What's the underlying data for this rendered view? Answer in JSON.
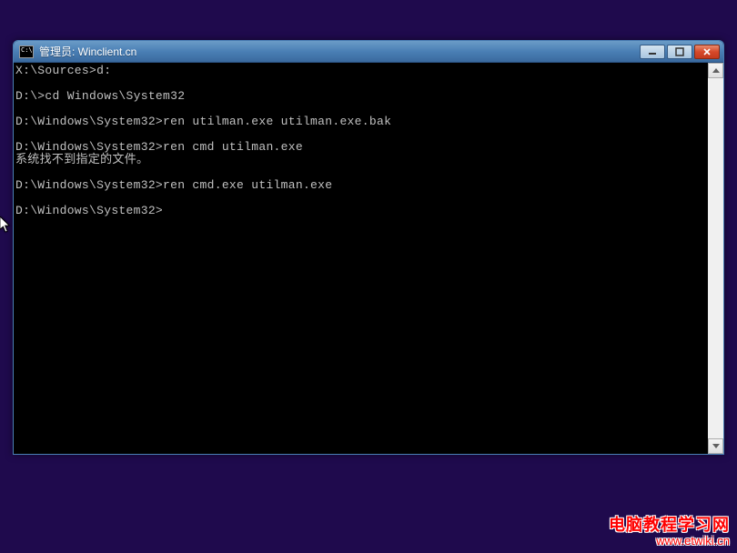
{
  "window": {
    "title": "管理员:  Winclient.cn"
  },
  "terminal": {
    "lines": [
      {
        "prompt": "X:\\Sources>",
        "command": "d:"
      },
      {
        "prompt": "",
        "command": ""
      },
      {
        "prompt": "D:\\>",
        "command": "cd Windows\\System32"
      },
      {
        "prompt": "",
        "command": ""
      },
      {
        "prompt": "D:\\Windows\\System32>",
        "command": "ren utilman.exe utilman.exe.bak"
      },
      {
        "prompt": "",
        "command": ""
      },
      {
        "prompt": "D:\\Windows\\System32>",
        "command": "ren cmd utilman.exe"
      },
      {
        "prompt": "",
        "command": "系统找不到指定的文件。"
      },
      {
        "prompt": "",
        "command": ""
      },
      {
        "prompt": "D:\\Windows\\System32>",
        "command": "ren cmd.exe utilman.exe"
      },
      {
        "prompt": "",
        "command": ""
      },
      {
        "prompt": "D:\\Windows\\System32>",
        "command": ""
      }
    ]
  },
  "watermark": {
    "line1": "电脑教程学习网",
    "line2": "www.etwiki.cn"
  }
}
